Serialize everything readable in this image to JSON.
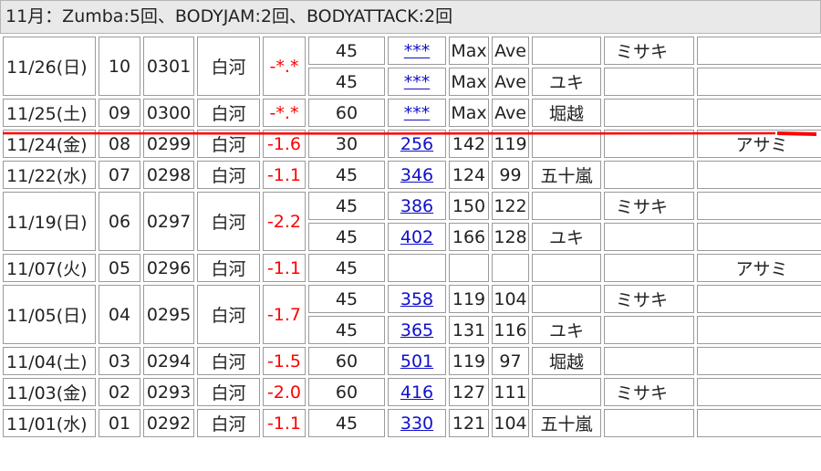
{
  "header": {
    "summary": "11月：Zumba:5回、BODYJAM:2回、BODYATTACK:2回"
  },
  "marker_color": "#ff0000",
  "groups": [
    {
      "date": "11/26(日)",
      "num": "10",
      "code": "0301",
      "place": "白河",
      "change": "-*.*",
      "rows": [
        {
          "min": "45",
          "link": "***",
          "max": "Max",
          "ave": "Ave",
          "inst1": "",
          "inst2": "ミサキ",
          "inst3": ""
        },
        {
          "min": "45",
          "link": "***",
          "max": "Max",
          "ave": "Ave",
          "inst1": "ユキ",
          "inst2": "",
          "inst3": ""
        }
      ]
    },
    {
      "date": "11/25(土)",
      "num": "09",
      "code": "0300",
      "place": "白河",
      "change": "-*.*",
      "rows": [
        {
          "min": "60",
          "link": "***",
          "max": "Max",
          "ave": "Ave",
          "inst1": "堀越",
          "inst2": "",
          "inst3": ""
        }
      ]
    },
    {
      "date": "11/24(金)",
      "num": "08",
      "code": "0299",
      "place": "白河",
      "change": "-1.6",
      "rows": [
        {
          "min": "30",
          "link": "256",
          "max": "142",
          "ave": "119",
          "inst1": "",
          "inst2": "",
          "inst3": "アサミ"
        }
      ]
    },
    {
      "date": "11/22(水)",
      "num": "07",
      "code": "0298",
      "place": "白河",
      "change": "-1.1",
      "rows": [
        {
          "min": "45",
          "link": "346",
          "max": "124",
          "ave": "99",
          "inst1": "五十嵐",
          "inst2": "",
          "inst3": ""
        }
      ]
    },
    {
      "date": "11/19(日)",
      "num": "06",
      "code": "0297",
      "place": "白河",
      "change": "-2.2",
      "rows": [
        {
          "min": "45",
          "link": "386",
          "max": "150",
          "ave": "122",
          "inst1": "",
          "inst2": "ミサキ",
          "inst3": ""
        },
        {
          "min": "45",
          "link": "402",
          "max": "166",
          "ave": "128",
          "inst1": "ユキ",
          "inst2": "",
          "inst3": ""
        }
      ]
    },
    {
      "date": "11/07(火)",
      "num": "05",
      "code": "0296",
      "place": "白河",
      "change": "-1.1",
      "rows": [
        {
          "min": "45",
          "link": "",
          "max": "",
          "ave": "",
          "inst1": "",
          "inst2": "",
          "inst3": "アサミ"
        }
      ]
    },
    {
      "date": "11/05(日)",
      "num": "04",
      "code": "0295",
      "place": "白河",
      "change": "-1.7",
      "rows": [
        {
          "min": "45",
          "link": "358",
          "max": "119",
          "ave": "104",
          "inst1": "",
          "inst2": "ミサキ",
          "inst3": ""
        },
        {
          "min": "45",
          "link": "365",
          "max": "131",
          "ave": "116",
          "inst1": "ユキ",
          "inst2": "",
          "inst3": ""
        }
      ]
    },
    {
      "date": "11/04(土)",
      "num": "03",
      "code": "0294",
      "place": "白河",
      "change": "-1.5",
      "rows": [
        {
          "min": "60",
          "link": "501",
          "max": "119",
          "ave": "97",
          "inst1": "堀越",
          "inst2": "",
          "inst3": ""
        }
      ]
    },
    {
      "date": "11/03(金)",
      "num": "02",
      "code": "0293",
      "place": "白河",
      "change": "-2.0",
      "rows": [
        {
          "min": "60",
          "link": "416",
          "max": "127",
          "ave": "111",
          "inst1": "",
          "inst2": "ミサキ",
          "inst3": ""
        }
      ]
    },
    {
      "date": "11/01(水)",
      "num": "01",
      "code": "0292",
      "place": "白河",
      "change": "-1.1",
      "rows": [
        {
          "min": "45",
          "link": "330",
          "max": "121",
          "ave": "104",
          "inst1": "五十嵐",
          "inst2": "",
          "inst3": ""
        }
      ]
    }
  ]
}
